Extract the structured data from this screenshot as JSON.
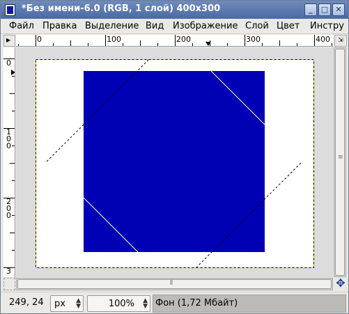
{
  "window": {
    "title": "*Без имени-6.0 (RGB, 1 слой) 400x300",
    "minimize_glyph": "_",
    "maximize_glyph": "□",
    "close_glyph": "✕"
  },
  "menu": [
    {
      "label": "Файл"
    },
    {
      "label": "Правка"
    },
    {
      "label": "Выделение"
    },
    {
      "label": "Вид"
    },
    {
      "label": "Изображение"
    },
    {
      "label": "Слой"
    },
    {
      "label": "Цвет"
    },
    {
      "label": "Инстру"
    }
  ],
  "ruler_top": {
    "labels": [
      "0",
      "100",
      "200",
      "300",
      "400"
    ]
  },
  "ruler_left": {
    "labels": [
      "0",
      "100",
      "200",
      "3"
    ]
  },
  "canvas": {
    "image_size": "400x300",
    "image_background": "#ffffff",
    "fill_color": "#0000b4",
    "canvas_background": "#dcdcdc",
    "selection_border_color": "#e6d200"
  },
  "status": {
    "coords": "249, 24",
    "unit": "px",
    "zoom": "100%",
    "message": "Фон (1,72 Мбайт)"
  },
  "icons": {
    "app": "gimp-image-icon",
    "nav": "navigate-arrows-icon",
    "quickmask": "quick-mask-icon"
  }
}
